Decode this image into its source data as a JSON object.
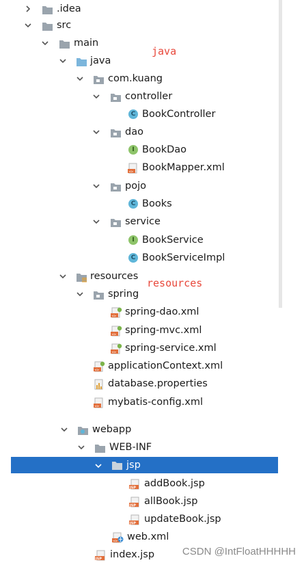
{
  "tree": {
    "idea": ".idea",
    "src": "src",
    "main": "main",
    "java": "java",
    "pkg": "com.kuang",
    "controller": "controller",
    "book_controller": "BookController",
    "dao": "dao",
    "book_dao": "BookDao",
    "book_mapper": "BookMapper.xml",
    "pojo": "pojo",
    "books": "Books",
    "service": "service",
    "book_service": "BookService",
    "book_service_impl": "BookServiceImpl",
    "resources": "resources",
    "spring": "spring",
    "spring_dao": "spring-dao.xml",
    "spring_mvc": "spring-mvc.xml",
    "spring_service": "spring-service.xml",
    "app_context": "applicationContext.xml",
    "db_props": "database.properties",
    "mybatis_config": "mybatis-config.xml",
    "webapp": "webapp",
    "web_inf": "WEB-INF",
    "jsp": "jsp",
    "add_book": "addBook.jsp",
    "all_book": "allBook.jsp",
    "update_book": "updateBook.jsp",
    "web_xml": "web.xml",
    "index_jsp": "index.jsp"
  },
  "annotations": {
    "java_note": "java",
    "resources_note": "resources"
  },
  "watermark": "CSDN @IntFloatHHHHH",
  "colors": {
    "selection": "#2470c6",
    "annotation": "#e8473a",
    "folder": "#9aa4ad",
    "source_folder": "#7cb6dc",
    "class_icon": "#5fb6d9",
    "interface_icon": "#8ec46a",
    "xml_icon": "#e26e3a"
  }
}
